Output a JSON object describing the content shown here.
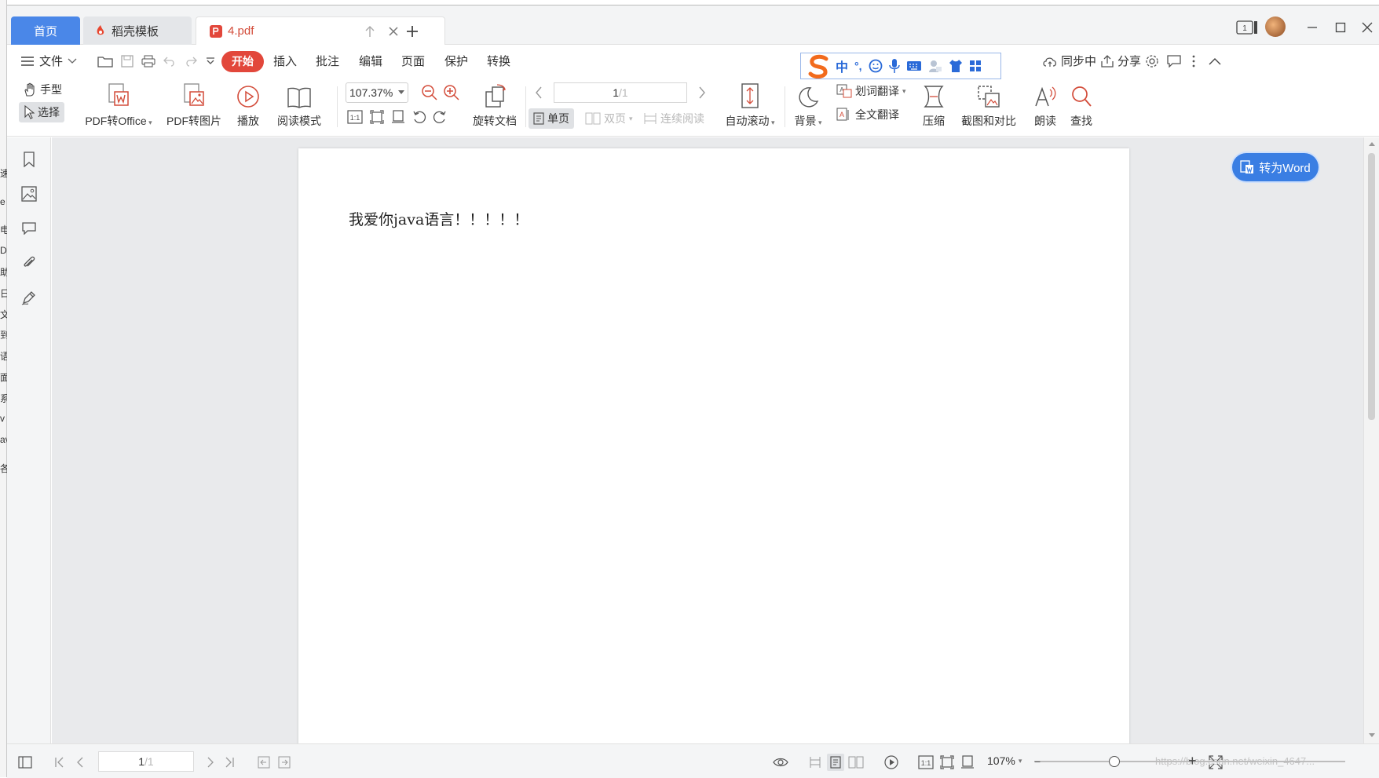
{
  "behind_window": {
    "chars": [
      "速",
      "e",
      "电",
      "D",
      "助",
      "日",
      "文",
      "到",
      "语",
      "面",
      "系",
      "v",
      "av",
      "各"
    ]
  },
  "tabs": {
    "home": "首页",
    "template": "稻壳模板",
    "pdf": "4.pdf"
  },
  "window": {
    "layout_badge": "1"
  },
  "menu": {
    "file": "文件",
    "start": "开始",
    "insert": "插入",
    "annotate": "批注",
    "edit": "编辑",
    "page": "页面",
    "protect": "保护",
    "convert": "转换",
    "sync": "同步中",
    "share": "分享"
  },
  "ime": {
    "mode": "中",
    "punct": "°,"
  },
  "ribbon": {
    "hand": "手型",
    "select": "选择",
    "pdf_to_office": "PDF转Office",
    "pdf_to_image": "PDF转图片",
    "play": "播放",
    "read_mode": "阅读模式",
    "zoom": "107.37%",
    "rotate_doc": "旋转文档",
    "page_num": "1",
    "page_total": "/1",
    "single_page": "单页",
    "double_page": "双页",
    "continuous": "连续阅读",
    "auto_scroll": "自动滚动",
    "background": "背景",
    "word_translate": "划词翻译",
    "full_translate": "全文翻译",
    "compress": "压缩",
    "screenshot_compare": "截图和对比",
    "read_aloud": "朗读",
    "find": "查找"
  },
  "document": {
    "text": "我爱你java语言！！！！！"
  },
  "to_word_button": "转为Word",
  "status": {
    "page_num": "1",
    "page_total": "/1",
    "zoom": "107%",
    "watermark": "https://blog.csdn.net/weixin_4647..."
  },
  "colors": {
    "accent": "#4a87e8",
    "start_tab": "#e2473b",
    "pdf_red": "#d34c3a",
    "to_word": "#3a7ee3"
  }
}
